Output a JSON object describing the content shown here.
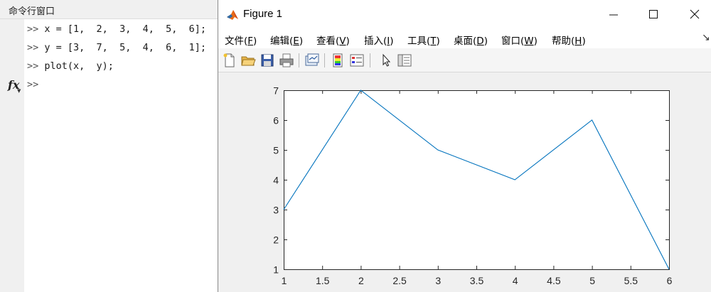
{
  "command_window": {
    "title": "命令行窗口",
    "prompt": ">>",
    "lines": [
      "x = [1,  2,  3,  4,  5,  6];",
      "y = [3,  7,  5,  4,  6,  1];",
      "plot(x,  y);",
      ""
    ],
    "fx_icon": "fx-icon"
  },
  "figure": {
    "title": "Figure 1",
    "logo_icon": "matlab-logo-icon",
    "window_buttons": [
      "minimize-icon",
      "maximize-icon",
      "close-icon"
    ],
    "menu": [
      {
        "label": "文件(",
        "key": "F",
        "suffix": ")"
      },
      {
        "label": "编辑(",
        "key": "E",
        "suffix": ")"
      },
      {
        "label": "查看(",
        "key": "V",
        "suffix": ")"
      },
      {
        "label": "插入(",
        "key": "I",
        "suffix": ")"
      },
      {
        "label": "工具(",
        "key": "T",
        "suffix": ")"
      },
      {
        "label": "桌面(",
        "key": "D",
        "suffix": ")"
      },
      {
        "label": "窗口(",
        "key": "W",
        "suffix": ")"
      },
      {
        "label": "帮助(",
        "key": "H",
        "suffix": ")"
      }
    ],
    "toolbar_icons": [
      "new-figure-icon",
      "open-file-icon",
      "save-icon",
      "print-icon",
      "link-plot-icon",
      "insert-colorbar-icon",
      "insert-legend-icon",
      "edit-plot-icon",
      "property-editor-icon"
    ],
    "line_color": "#0072bd"
  },
  "chart_data": {
    "type": "line",
    "x": [
      1,
      2,
      3,
      4,
      5,
      6
    ],
    "series": [
      {
        "values": [
          3,
          7,
          5,
          4,
          6,
          1
        ]
      }
    ],
    "title": "",
    "xlabel": "",
    "ylabel": "",
    "xlim": [
      1,
      6
    ],
    "ylim": [
      1,
      7
    ],
    "xticks": [
      "1",
      "1.5",
      "2",
      "2.5",
      "3",
      "3.5",
      "4",
      "4.5",
      "5",
      "5.5",
      "6"
    ],
    "yticks": [
      "1",
      "2",
      "3",
      "4",
      "5",
      "6",
      "7"
    ],
    "grid": false,
    "legend": "none"
  }
}
